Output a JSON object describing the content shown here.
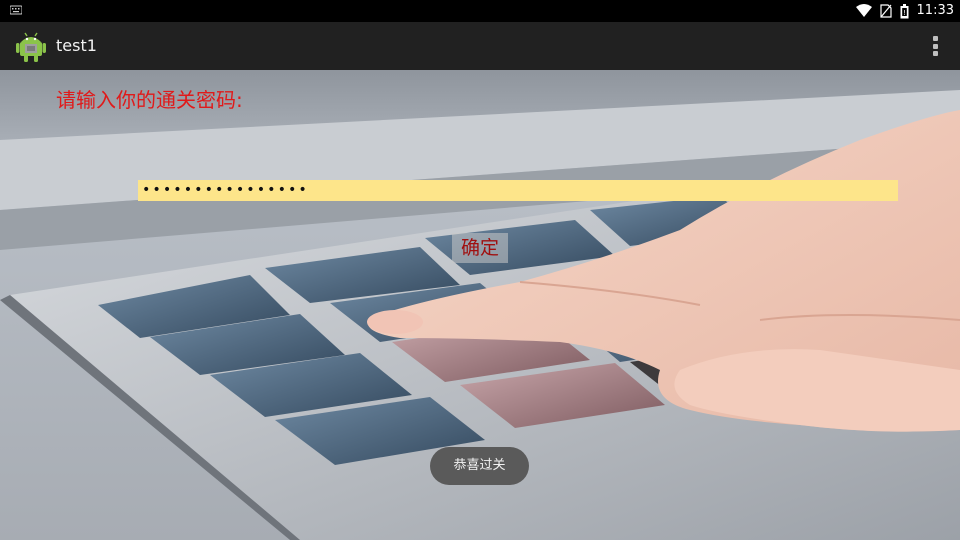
{
  "status_bar": {
    "time": "11:33",
    "icons": [
      "keyboard-icon",
      "wifi-icon",
      "no-sim-icon",
      "battery-icon"
    ]
  },
  "action_bar": {
    "title": "test1",
    "app_icon": "android-icon",
    "overflow_icon": "more-vert-icon"
  },
  "form": {
    "prompt": "请输入你的通关密码:",
    "password_value": "••••••••••••••••",
    "confirm_label": "确定"
  },
  "toast": {
    "message": "恭喜过关"
  },
  "colors": {
    "prompt_text": "#e01a1a",
    "field_background": "#fde58a",
    "confirm_text": "#a01010",
    "action_bar": "#212121",
    "status_bar": "#000000"
  }
}
